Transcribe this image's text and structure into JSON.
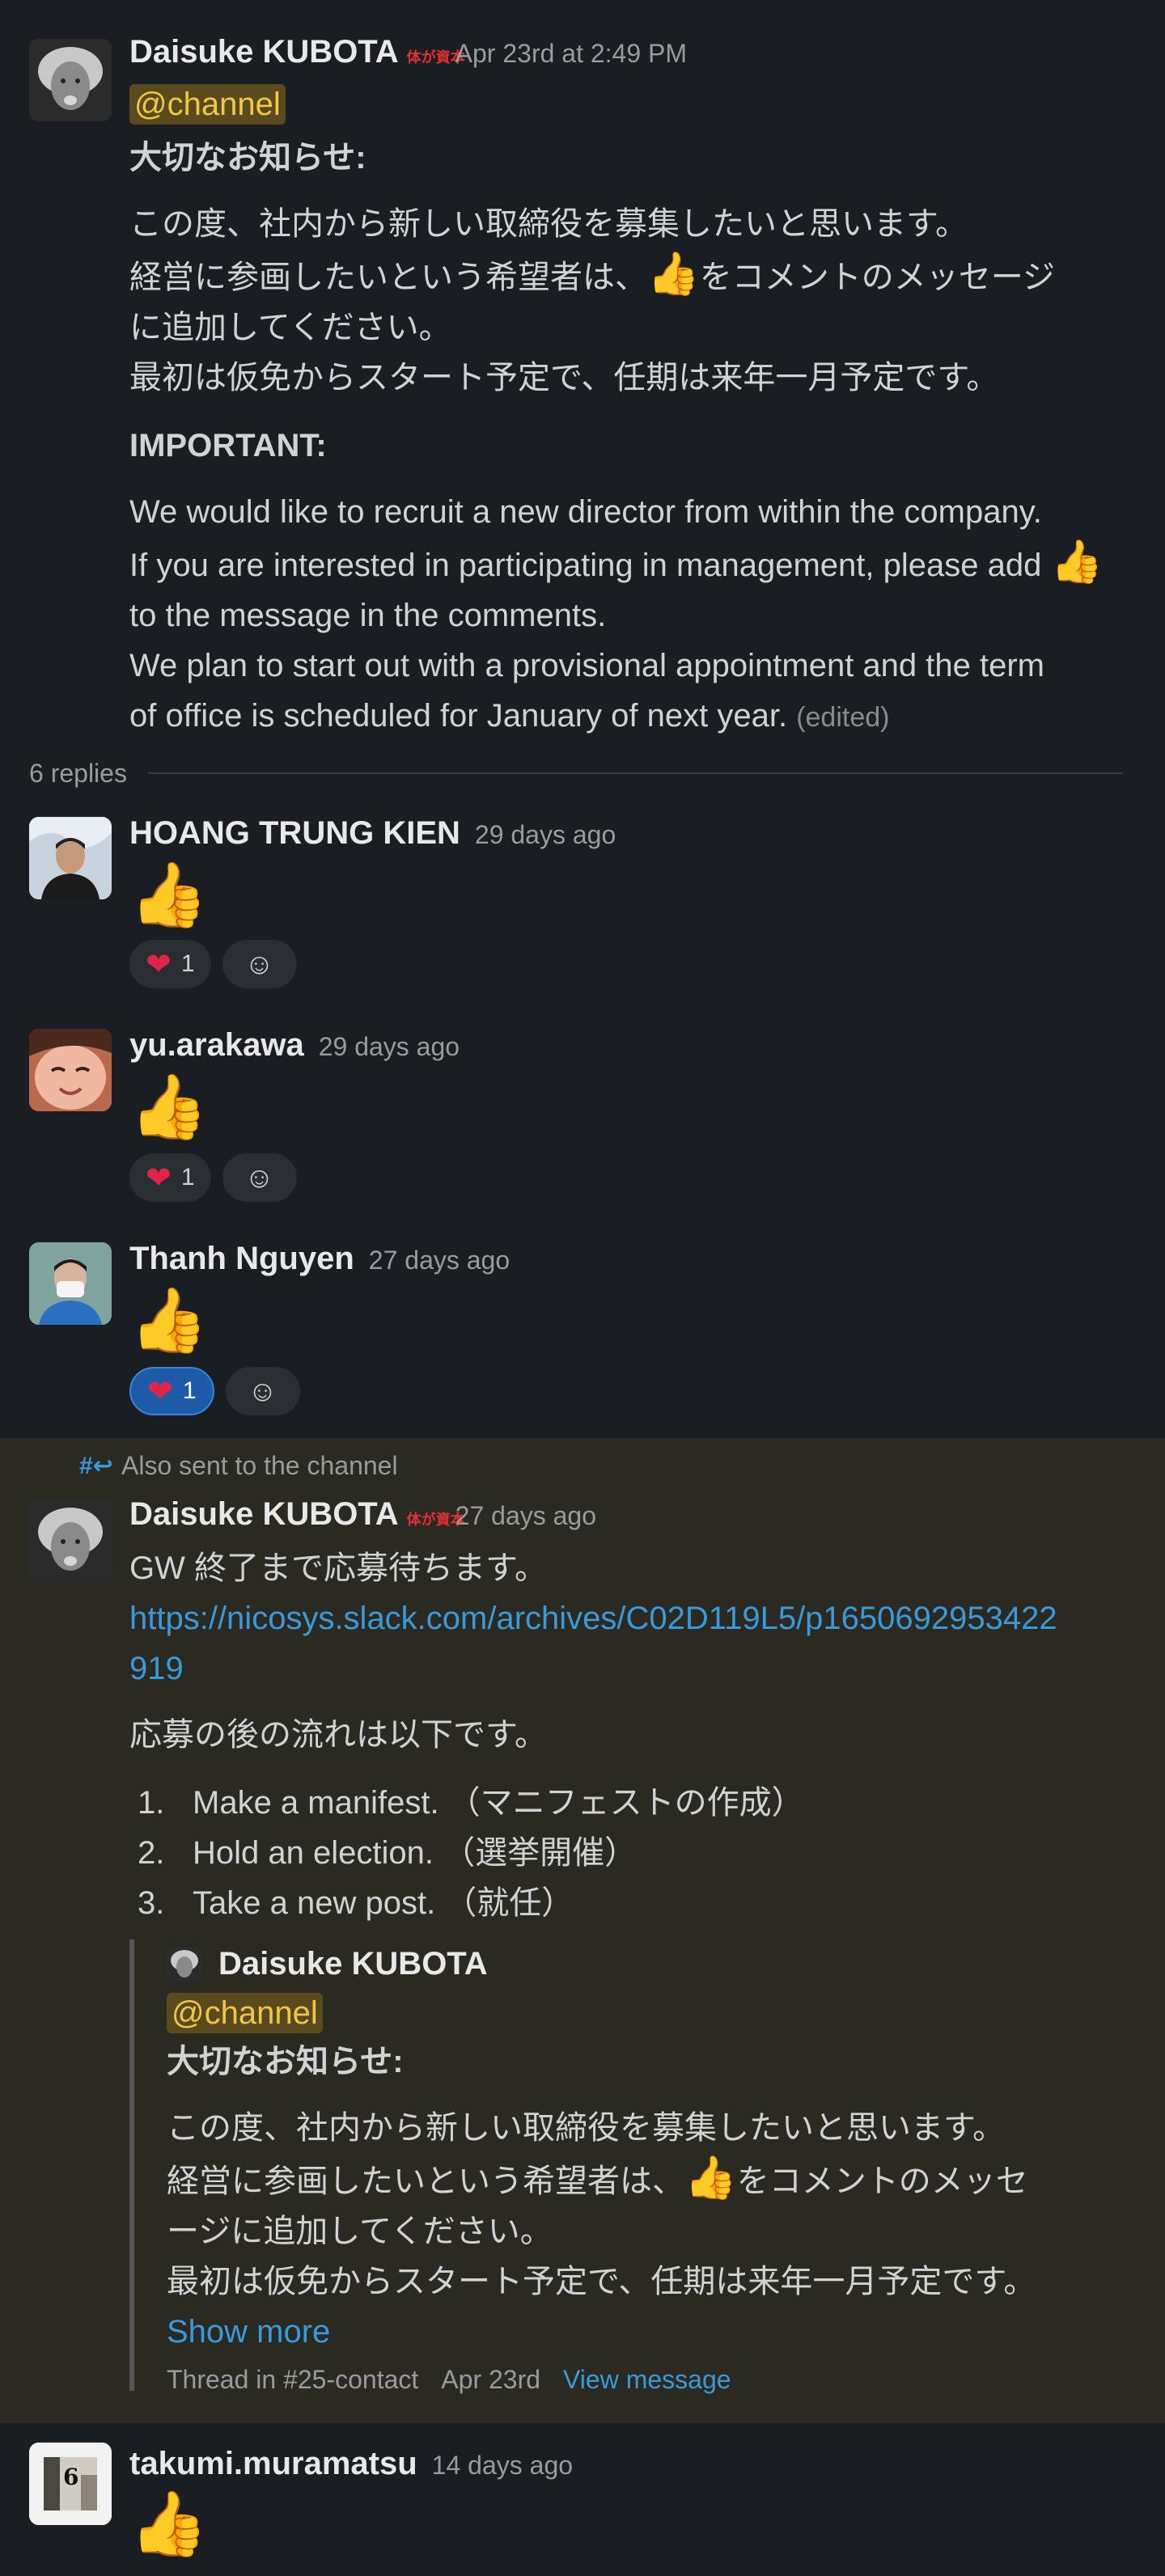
{
  "original_post": {
    "author": "Daisuke KUBOTA",
    "status_badge": "体が資本",
    "time": "Apr 23rd at 2:49 PM",
    "mention": "@channel",
    "jp_heading": "大切なお知らせ:",
    "jp_line1": "この度、社内から新しい取締役を募集したいと思います。",
    "jp_line2a": "経営に参画したいという希望者は、",
    "jp_line2b": "をコメントのメッセージ",
    "jp_line3": "に追加してください。",
    "jp_line4": "最初は仮免からスタート予定で、任期は来年一月予定です。",
    "en_heading": "IMPORTANT:",
    "en_line1": "We would like to recruit a new director from within the company.",
    "en_line2": "If you are interested in participating in management, please add",
    "en_line3": "to the message in the comments.",
    "en_line4": "We plan to start out with a provisional appointment and the term",
    "en_line5": "of office is scheduled for January of next year.",
    "edited": "(edited)"
  },
  "replies_label": "6 replies",
  "emoji": {
    "thumb": "👍",
    "heart": "❤"
  },
  "replies": [
    {
      "author": "HOANG TRUNG KIEN",
      "time": "29 days ago",
      "reaction_count": "1",
      "reaction_active": false
    },
    {
      "author": "yu.arakawa",
      "time": "29 days ago",
      "reaction_count": "1",
      "reaction_active": false
    },
    {
      "author": "Thanh Nguyen",
      "time": "27 days ago",
      "reaction_count": "1",
      "reaction_active": true
    }
  ],
  "channel_post": {
    "also_sent": "Also sent to the channel",
    "author": "Daisuke KUBOTA",
    "status_badge": "体が資本",
    "time": "27 days ago",
    "line1": "GW 終了まで応募待ちます。",
    "link_a": "https://nicosys.slack.com/archives/C02D119L5/p1650692953422",
    "link_b": "919",
    "flow_intro": "応募の後の流れは以下です。",
    "steps": [
      {
        "num": "1.",
        "text": "Make a manifest. （マニフェストの作成）"
      },
      {
        "num": "2.",
        "text": "Hold an election. （選挙開催）"
      },
      {
        "num": "3.",
        "text": "Take a new post. （就任）"
      }
    ],
    "quote": {
      "author": "Daisuke KUBOTA",
      "mention": "@channel",
      "heading": "大切なお知らせ:",
      "line1": "この度、社内から新しい取締役を募集したいと思います。",
      "line2a": "経営に参画したいという希望者は、",
      "line2b": "をコメントのメッセ",
      "line3": "ージに追加してください。",
      "line4": "最初は仮免からスタート予定で、任期は来年一月予定です。",
      "show_more": "Show more",
      "footer_thread": "Thread in #25-contact",
      "footer_date": "Apr 23rd",
      "footer_view": "View message"
    }
  },
  "last_reply": {
    "author": "takumi.muramatsu",
    "time": "14 days ago",
    "avatar_label": "6"
  },
  "colors": {
    "background": "#1a1d21",
    "highlight_background": "#2a2a23",
    "link": "#3a9ad9",
    "mention": "#f2c744",
    "reaction_active": "#1d5ba8"
  }
}
